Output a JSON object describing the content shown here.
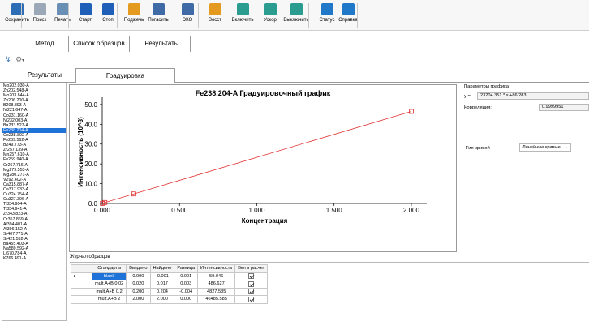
{
  "toolbar": {
    "buttons": [
      {
        "label": "Сохранить",
        "icon": "save-icon",
        "color": "#2d6db5"
      },
      {
        "label": "Поиск",
        "icon": "search-doc-icon",
        "color": "#9aa8b8"
      },
      {
        "label": "Печать",
        "icon": "print-icon",
        "color": "#6a8fb5"
      },
      {
        "label": "Старт",
        "icon": "play-icon",
        "color": "#1f5fb8"
      },
      {
        "label": "Стоп",
        "icon": "stop-icon",
        "color": "#1f5fb8"
      },
      {
        "label": "Поджечь",
        "icon": "flame-icon",
        "color": "#e39a1e"
      },
      {
        "label": "Погасить",
        "icon": "flame-off-icon",
        "color": "#3f6aa6"
      },
      {
        "label": "ЭКО",
        "icon": "eco-icon",
        "color": "#3f6aa6"
      },
      {
        "label": "Восст",
        "icon": "restore-icon",
        "color": "#e39a1e"
      },
      {
        "label": "Включить",
        "icon": "power-on-icon",
        "color": "#2a9c90"
      },
      {
        "label": "Ускор",
        "icon": "accelerate-icon",
        "color": "#2a9c90"
      },
      {
        "label": "Выключить",
        "icon": "power-off-icon",
        "color": "#2a9c90"
      },
      {
        "label": "Статус",
        "icon": "info-icon",
        "color": "#1f78c8"
      },
      {
        "label": "Справка",
        "icon": "help-icon",
        "color": "#1f78c8"
      }
    ]
  },
  "main_tabs": [
    "Метод",
    "Список образцов",
    "Результаты"
  ],
  "sub_tabs": [
    "Результаты",
    "Градуировка"
  ],
  "samples": [
    "Mo202.030-A",
    "Zn202.548-A",
    "Mo203.844-A",
    "Zn206.200-A",
    "B208.893-A",
    "Ni221.647-A",
    "Co231.160-A",
    "Ni232.003-A",
    "Ba233.527-A",
    "Fe238.204-A",
    "Co238.892-A",
    "Fe239.562-A",
    "B249.773-A",
    "Zr257.139-A",
    "Mn257.610-A",
    "Fe259.940-A",
    "Cr267.716-A",
    "Mg279.553-A",
    "Mg280.271-A",
    "V292.402-A",
    "Ca315.887-A",
    "Ca317.933-A",
    "Cu324.754-A",
    "Cu327.396-A",
    "Ti334.904-A",
    "Ti334.941-A",
    "Zr343.823-A",
    "Cr357.869-A",
    "Al394.401-A",
    "Al396.152-A",
    "Sr407.771-A",
    "Sr421.552-A",
    "Ba455.403-A",
    "Na589.592-A",
    "Li670.784-A",
    "K766.491-A"
  ],
  "selected_sample": "Fe238.204-A",
  "chart_data": {
    "type": "scatter",
    "title": "Fe238.204-A Градуировочный график",
    "xlabel": "Концентрация",
    "ylabel": "Интенсивность (10^3)",
    "xlim": [
      0,
      2.1
    ],
    "ylim": [
      0,
      52
    ],
    "x_ticks": [
      "0.000",
      "0.500",
      "1.000",
      "1.500",
      "2.000"
    ],
    "y_ticks": [
      "0.0",
      "10.0",
      "20.0",
      "30.0",
      "40.0",
      "50.0"
    ],
    "series": [
      {
        "x": [
          0.001,
          0.017,
          0.204,
          2.0
        ],
        "y": [
          0.059,
          0.487,
          4.828,
          46.486
        ],
        "color": "#e03030"
      }
    ],
    "fit_line": {
      "x": [
        0,
        2.0
      ],
      "y": [
        0.086,
        46.49
      ],
      "color": "#e03030"
    },
    "grid": false
  },
  "journal": {
    "title": "Журнал образцов",
    "headers": [
      "Стандарты",
      "Введено",
      "Найдено",
      "Разница",
      "Интенсивность",
      "Вкл в расчет"
    ],
    "rows": [
      [
        "blank",
        "0.000",
        "-0.001",
        "0.001",
        "59.046",
        true
      ],
      [
        "mult.A+B 0.02",
        "0.020",
        "0.017",
        "0.003",
        "486.627",
        true
      ],
      [
        "mult.A+B 0.2",
        "0.200",
        "0.204",
        "-0.004",
        "4827.535",
        true
      ],
      [
        "mult.A+B 2",
        "2.000",
        "2.000",
        "0.000",
        "46485.585",
        true
      ]
    ],
    "current_row_marker": "▸"
  },
  "params": {
    "title": "Параметры графика",
    "eq_label": "y =",
    "equation": "23204.351 * x +86.283",
    "corr_label": "Корреляция:",
    "corr_value": "0.9999951",
    "curve_type_label": "Тип кривой",
    "curve_type_value": "Линейные кривые"
  },
  "sub_toolbar": {
    "refresh": "↯",
    "options": "⚙"
  }
}
